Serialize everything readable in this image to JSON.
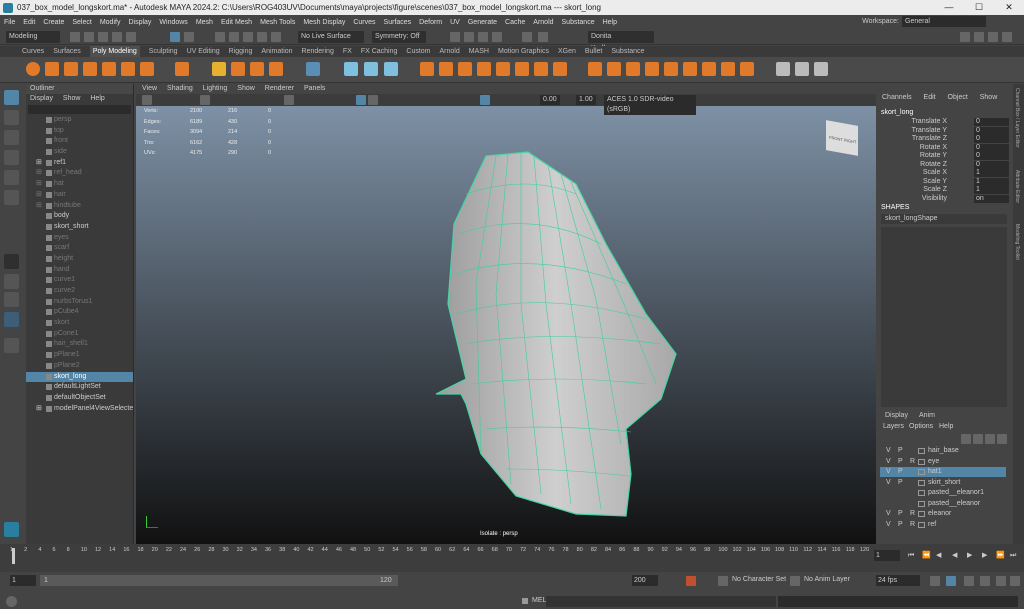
{
  "title": "037_box_model_longskort.ma* - Autodesk MAYA 2024.2: C:\\Users\\ROG403UV\\Documents\\maya\\projects\\figure\\scenes\\037_box_model_longskort.ma   ---   skort_long",
  "menu": [
    "File",
    "Edit",
    "Create",
    "Select",
    "Modify",
    "Display",
    "Windows",
    "Mesh",
    "Edit Mesh",
    "Mesh Tools",
    "Mesh Display",
    "Curves",
    "Surfaces",
    "Deform",
    "UV",
    "Generate",
    "Cache",
    "Arnold",
    "Substance",
    "Help"
  ],
  "workspace": {
    "label": "Workspace:",
    "value": "General"
  },
  "status": {
    "mode": "Modeling",
    "live": "No Live Surface",
    "symmetry": "Symmetry: Off",
    "user": "Donita Kadharusman"
  },
  "shelf_tabs": [
    "Curves",
    "Surfaces",
    "Poly Modeling",
    "Sculpting",
    "UV Editing",
    "Rigging",
    "Animation",
    "Rendering",
    "FX",
    "FX Caching",
    "Custom",
    "Arnold",
    "MASH",
    "Motion Graphics",
    "XGen",
    "Bullet",
    "Substance"
  ],
  "outliner": {
    "title": "Outliner",
    "menu": [
      "Display",
      "Show",
      "Help"
    ],
    "items": [
      "persp",
      "top",
      "front",
      "side",
      "ref1",
      "ref_head",
      "hat",
      "hair",
      "hindtube",
      "body",
      "skort_short",
      "eyes",
      "scarf",
      "height",
      "hand",
      "curve1",
      "curve2",
      "nurbsTorus1",
      "pCube4",
      "skort",
      "pCone1",
      "hair_shell1",
      "pPlane1",
      "pPlane2",
      "skort_long",
      "defaultLightSet",
      "defaultObjectSet",
      "modelPanel4ViewSelectedSet"
    ]
  },
  "viewport": {
    "menu": [
      "View",
      "Shading",
      "Lighting",
      "Show",
      "Renderer",
      "Panels"
    ],
    "exposure": "0.00",
    "gamma": "1.00",
    "colorspace": "ACES 1.0 SDR-video (sRGB)",
    "isolate": "Isolate : persp",
    "cube_front": "FRONT",
    "cube_right": "RIGHT"
  },
  "hud": [
    {
      "label": "Verts:",
      "a": "2100",
      "b": "216",
      "c": "0"
    },
    {
      "label": "Edges:",
      "a": "6189",
      "b": "430",
      "c": "0"
    },
    {
      "label": "Faces:",
      "a": "3094",
      "c": "0",
      "b": "214"
    },
    {
      "label": "Tris:",
      "a": "6162",
      "b": "428",
      "c": "0"
    },
    {
      "label": "UVs:",
      "a": "4175",
      "b": "290",
      "c": "0"
    }
  ],
  "channelbox": {
    "menu": [
      "Channels",
      "Edit",
      "Object",
      "Show"
    ],
    "object": "skort_long",
    "attrs": [
      {
        "n": "Translate X",
        "v": "0"
      },
      {
        "n": "Translate Y",
        "v": "0"
      },
      {
        "n": "Translate Z",
        "v": "0"
      },
      {
        "n": "Rotate X",
        "v": "0"
      },
      {
        "n": "Rotate Y",
        "v": "0"
      },
      {
        "n": "Rotate Z",
        "v": "0"
      },
      {
        "n": "Scale X",
        "v": "1"
      },
      {
        "n": "Scale Y",
        "v": "1"
      },
      {
        "n": "Scale Z",
        "v": "1"
      },
      {
        "n": "Visibility",
        "v": "on"
      }
    ],
    "shapes": "SHAPES",
    "shape": "skort_longShape"
  },
  "sidetabs": [
    "Channel Box / Layer Editor",
    "Attribute Editor",
    "Modeling Toolkit"
  ],
  "layers": {
    "tabs": [
      "Display",
      "Anim"
    ],
    "menu": [
      "Layers",
      "Options",
      "Help"
    ],
    "rows": [
      {
        "v": "V",
        "p": "P",
        "r": "",
        "n": "hair_base"
      },
      {
        "v": "V",
        "p": "P",
        "r": "R",
        "n": "eye"
      },
      {
        "v": "V",
        "p": "P",
        "r": "",
        "n": "hat1"
      },
      {
        "v": "V",
        "p": "P",
        "r": "",
        "n": "skirt_short"
      },
      {
        "v": "",
        "p": "",
        "r": "",
        "n": "pasted__eleanor1"
      },
      {
        "v": "",
        "p": "",
        "r": "",
        "n": "pasted__eleanor"
      },
      {
        "v": "V",
        "p": "P",
        "r": "R",
        "n": "eleanor"
      },
      {
        "v": "V",
        "p": "P",
        "r": "R",
        "n": "ref"
      }
    ]
  },
  "timeline": {
    "ticks": [
      "1",
      "2",
      "4",
      "6",
      "8",
      "10",
      "12",
      "14",
      "16",
      "18",
      "20",
      "22",
      "24",
      "26",
      "28",
      "30",
      "32",
      "34",
      "36",
      "38",
      "40",
      "42",
      "44",
      "46",
      "48",
      "50",
      "52",
      "54",
      "56",
      "58",
      "60",
      "62",
      "64",
      "66",
      "68",
      "70",
      "72",
      "74",
      "76",
      "78",
      "80",
      "82",
      "84",
      "86",
      "88",
      "90",
      "92",
      "94",
      "96",
      "98",
      "100",
      "102",
      "104",
      "106",
      "108",
      "110",
      "112",
      "114",
      "116",
      "118",
      "120"
    ],
    "current": "1"
  },
  "range": {
    "start": "1",
    "inner_start": "1",
    "inner_end": "120",
    "end": "200",
    "charset": "No Character Set",
    "animlayer": "No Anim Layer",
    "fps": "24 fps"
  },
  "cmd": {
    "label": "MEL"
  }
}
